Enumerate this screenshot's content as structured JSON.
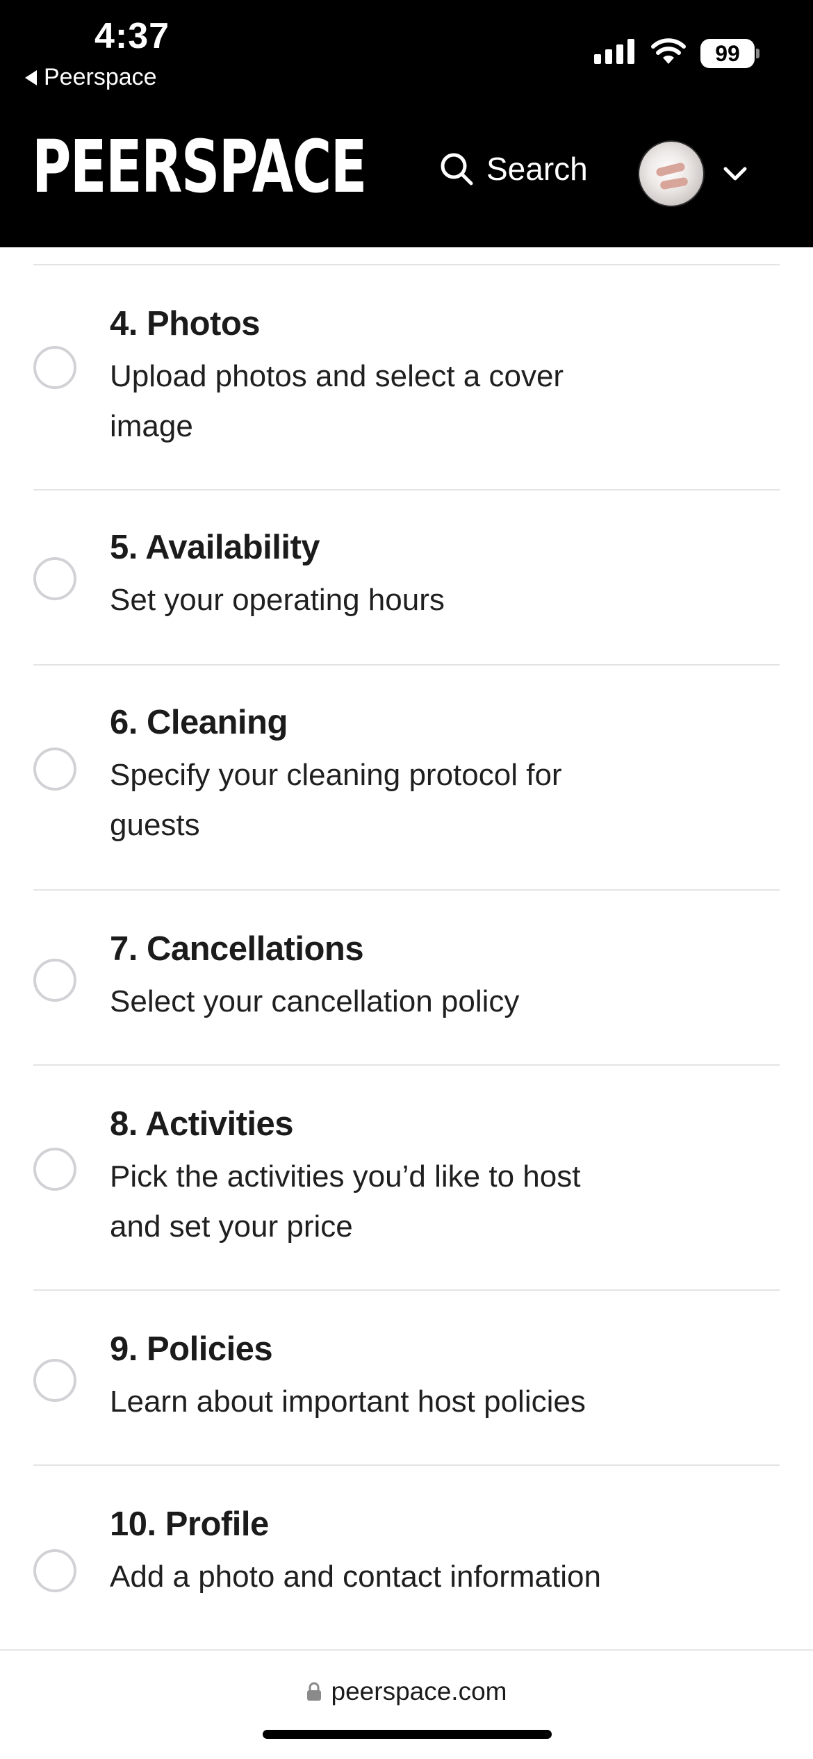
{
  "status_bar": {
    "time": "4:37",
    "back_app": "Peerspace",
    "battery": "99"
  },
  "header": {
    "logo": "PEERSPACE",
    "search_label": "Search"
  },
  "steps": [
    {
      "title": "4. Photos",
      "description": "Upload photos and select a cover image",
      "completed": false
    },
    {
      "title": "5. Availability",
      "description": "Set your operating hours",
      "completed": false
    },
    {
      "title": "6. Cleaning",
      "description": "Specify your cleaning protocol for guests",
      "completed": false
    },
    {
      "title": "7. Cancellations",
      "description": "Select your cancellation policy",
      "completed": false
    },
    {
      "title": "8. Activities",
      "description": "Pick the activities you’d like to host and set your price",
      "completed": false
    },
    {
      "title": "9. Policies",
      "description": "Learn about important host policies",
      "completed": false
    },
    {
      "title": "10. Profile",
      "description": "Add a photo and contact information",
      "completed": false
    }
  ],
  "browser": {
    "url": "peerspace.com"
  },
  "colors": {
    "header_bg": "#000000",
    "radio_border": "#d2d2d6",
    "divider": "#e4e4e4"
  }
}
